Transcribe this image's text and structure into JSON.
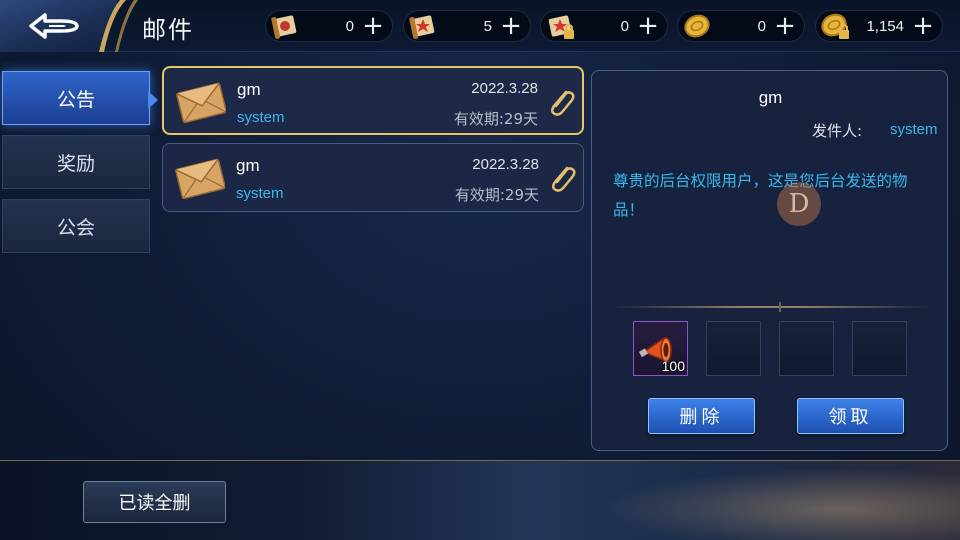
{
  "header": {
    "title": "邮件",
    "back_icon": "back-arrow-icon"
  },
  "currencies": [
    {
      "icon": "scroll-red-icon",
      "value": "0",
      "plus": "+"
    },
    {
      "icon": "scroll-star-icon",
      "value": "5",
      "plus": "+"
    },
    {
      "icon": "scroll-locked-icon",
      "value": "0",
      "plus": "+"
    },
    {
      "icon": "gold-coin-icon",
      "value": "0",
      "plus": "+"
    },
    {
      "icon": "gold-coin-locked-icon",
      "value": "1,154",
      "plus": "+"
    }
  ],
  "tabs": [
    {
      "label": "公告",
      "active": true
    },
    {
      "label": "奖励",
      "active": false
    },
    {
      "label": "公会",
      "active": false
    }
  ],
  "mails": [
    {
      "sender": "gm",
      "sub": "system",
      "date": "2022.3.28",
      "expire": "有效期:29天",
      "selected": true
    },
    {
      "sender": "gm",
      "sub": "system",
      "date": "2022.3.28",
      "expire": "有效期:29天",
      "selected": false
    }
  ],
  "detail": {
    "sender": "gm",
    "from_label": "发件人:",
    "from_value": "system",
    "body": "尊贵的后台权限用户，这是您后台发送的物品！",
    "watermark": "D",
    "attachments": [
      {
        "filled": true,
        "icon": "megaphone-icon",
        "qty": "100"
      },
      {
        "filled": false
      },
      {
        "filled": false
      },
      {
        "filled": false
      }
    ],
    "delete_label": "删除",
    "claim_label": "领取"
  },
  "footer": {
    "delete_all_label": "已读全删"
  },
  "colors": {
    "accent_blue": "#2f64c9",
    "highlight_gold": "#e8c46a",
    "link_cyan": "#3fb6ec"
  }
}
